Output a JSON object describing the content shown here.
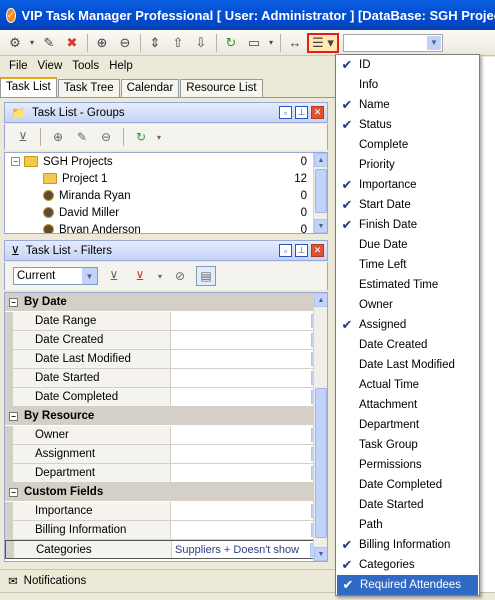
{
  "window": {
    "title": "VIP Task Manager Professional [ User: Administrator ] [DataBase: SGH Projects]"
  },
  "menu": [
    "File",
    "View",
    "Tools",
    "Help"
  ],
  "tabs": [
    "Task List",
    "Task Tree",
    "Calendar",
    "Resource List"
  ],
  "groups_panel": {
    "title": "Task List - Groups",
    "rows": [
      {
        "label": "SGH Projects",
        "count": "0",
        "level": 0
      },
      {
        "label": "Project 1",
        "count": "12",
        "level": 1
      },
      {
        "label": "Miranda Ryan",
        "count": "0",
        "level": 1
      },
      {
        "label": "David Miller",
        "count": "0",
        "level": 1
      },
      {
        "label": "Bryan Anderson",
        "count": "0",
        "level": 1
      }
    ]
  },
  "filters_panel": {
    "title": "Task List - Filters",
    "filter_select_value": "Current",
    "groups": [
      {
        "label": "By Date",
        "rows": [
          {
            "name": "Date Range",
            "value": ""
          },
          {
            "name": "Date Created",
            "value": ""
          },
          {
            "name": "Date Last Modified",
            "value": ""
          },
          {
            "name": "Date Started",
            "value": ""
          },
          {
            "name": "Date Completed",
            "value": ""
          }
        ]
      },
      {
        "label": "By Resource",
        "rows": [
          {
            "name": "Owner",
            "value": ""
          },
          {
            "name": "Assignment",
            "value": ""
          },
          {
            "name": "Department",
            "value": ""
          }
        ]
      },
      {
        "label": "Custom Fields",
        "rows": [
          {
            "name": "Importance",
            "value": ""
          },
          {
            "name": "Billing Information",
            "value": ""
          },
          {
            "name": "Categories",
            "value": "Suppliers + Doesn't show"
          }
        ]
      }
    ]
  },
  "notifications_label": "Notifications",
  "column_menu": {
    "items": [
      {
        "label": "ID",
        "checked": true
      },
      {
        "label": "Info",
        "checked": false
      },
      {
        "label": "Name",
        "checked": true
      },
      {
        "label": "Status",
        "checked": true
      },
      {
        "label": "Complete",
        "checked": false
      },
      {
        "label": "Priority",
        "checked": false
      },
      {
        "label": "Importance",
        "checked": true
      },
      {
        "label": "Start Date",
        "checked": true
      },
      {
        "label": "Finish Date",
        "checked": true
      },
      {
        "label": "Due Date",
        "checked": false
      },
      {
        "label": "Time Left",
        "checked": false
      },
      {
        "label": "Estimated Time",
        "checked": false
      },
      {
        "label": "Owner",
        "checked": false
      },
      {
        "label": "Assigned",
        "checked": true
      },
      {
        "label": "Date Created",
        "checked": false
      },
      {
        "label": "Date Last Modified",
        "checked": false
      },
      {
        "label": "Actual Time",
        "checked": false
      },
      {
        "label": "Attachment",
        "checked": false
      },
      {
        "label": "Department",
        "checked": false
      },
      {
        "label": "Task Group",
        "checked": false
      },
      {
        "label": "Permissions",
        "checked": false
      },
      {
        "label": "Date Completed",
        "checked": false
      },
      {
        "label": "Date Started",
        "checked": false
      },
      {
        "label": "Path",
        "checked": false
      },
      {
        "label": "Billing Information",
        "checked": true
      },
      {
        "label": "Categories",
        "checked": true
      },
      {
        "label": "Required Attendees",
        "checked": true,
        "selected": true
      }
    ]
  },
  "colors": {
    "title_blue": "#0450d3",
    "highlight": "#316ac5",
    "panel_header": "#c6d3f7",
    "alert_red": "#e02020"
  }
}
